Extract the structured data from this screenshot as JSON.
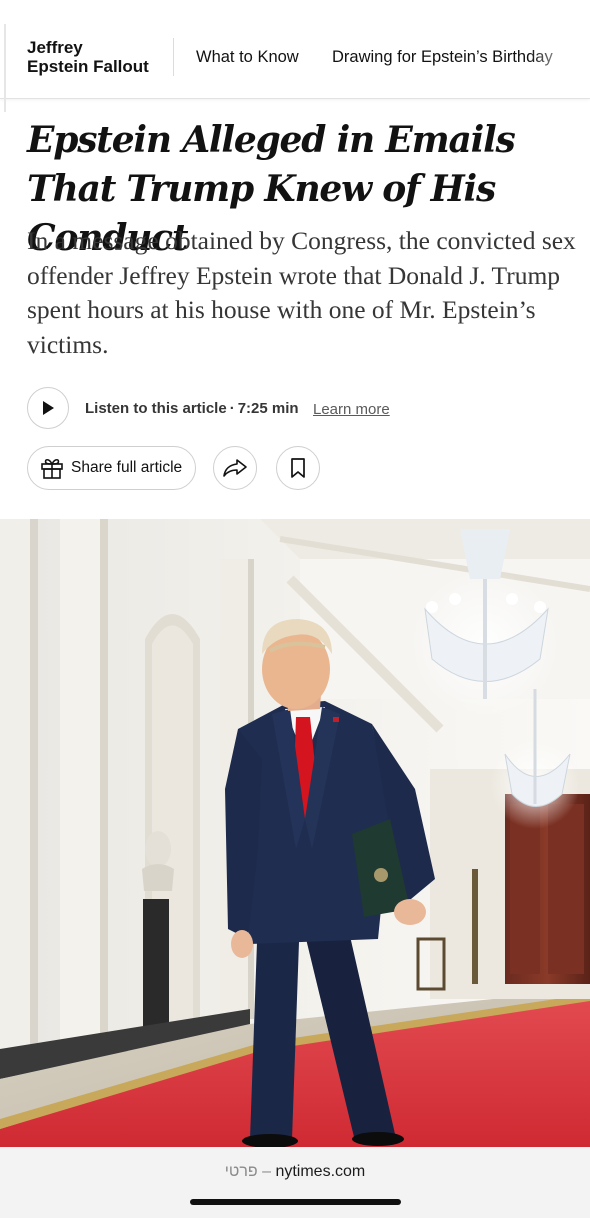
{
  "nav": {
    "section_title_line1": "Jeffrey",
    "section_title_line2": "Epstein Fallout",
    "links": [
      "What to Know",
      "Drawing for Epstein’s Birthday"
    ]
  },
  "article": {
    "headline": "Epstein Alleged in Emails That Trump Knew of His Conduct",
    "summary": "In a message obtained by Congress, the convicted sex offender Jeffrey Epstein wrote that Donald J. Trump spent hours at his house with one of Mr. Epstein’s victims."
  },
  "listen": {
    "label": "Listen to this article",
    "separator": "·",
    "duration": "7:25 min",
    "learn_more": "Learn more"
  },
  "actions": {
    "share_full_label": "Share full article",
    "share_icon": "share-arrow-icon",
    "save_icon": "bookmark-icon",
    "gift_icon": "gift-icon"
  },
  "browser": {
    "private_label": "פרטי",
    "dash": "–",
    "domain": "nytimes.com"
  },
  "colors": {
    "text": "#121212",
    "summary_text": "#363636",
    "carpet": "#d8313a",
    "suit": "#1c2a4a",
    "tie": "#d4141f"
  }
}
